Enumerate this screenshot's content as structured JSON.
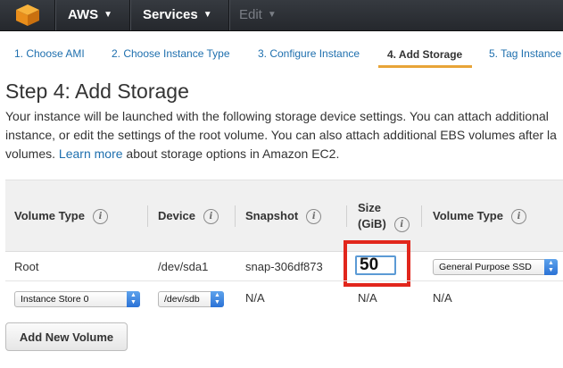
{
  "nav": {
    "brand": "AWS",
    "services": "Services",
    "edit": "Edit",
    "chevron": "▼"
  },
  "steps": [
    {
      "label": "1. Choose AMI",
      "active": false
    },
    {
      "label": "2. Choose Instance Type",
      "active": false
    },
    {
      "label": "3. Configure Instance",
      "active": false
    },
    {
      "label": "4. Add Storage",
      "active": true
    },
    {
      "label": "5. Tag Instance",
      "active": false
    }
  ],
  "page": {
    "title": "Step 4: Add Storage",
    "desc_line1": "Your instance will be launched with the following storage device settings. You can attach additional",
    "desc_line2": "instance, or edit the settings of the root volume. You can also attach additional EBS volumes after la",
    "desc_line3_pre": "volumes.  ",
    "learn_more": "Learn more",
    "desc_line3_post": " about storage options in Amazon EC2."
  },
  "table": {
    "headers": {
      "volume_type": "Volume Type",
      "device": "Device",
      "snapshot": "Snapshot",
      "size_line1": "Size",
      "size_line2": "(GiB)",
      "ebs_volume_type": "Volume Type"
    },
    "info_glyph": "i",
    "root_row": {
      "volume_type": "Root",
      "device": "/dev/sda1",
      "snapshot": "snap-306df873",
      "size": "50",
      "ebs_volume_type": "General Purpose SSD"
    },
    "instance_store_row": {
      "volume_type": "Instance Store 0",
      "device": "/dev/sdb",
      "snapshot": "N/A",
      "size": "N/A",
      "ebs_volume_type": "N/A"
    }
  },
  "buttons": {
    "add_new_volume": "Add New Volume"
  },
  "colors": {
    "accent": "#e8a438",
    "link": "#1e6fae",
    "highlight": "#e1261c"
  }
}
